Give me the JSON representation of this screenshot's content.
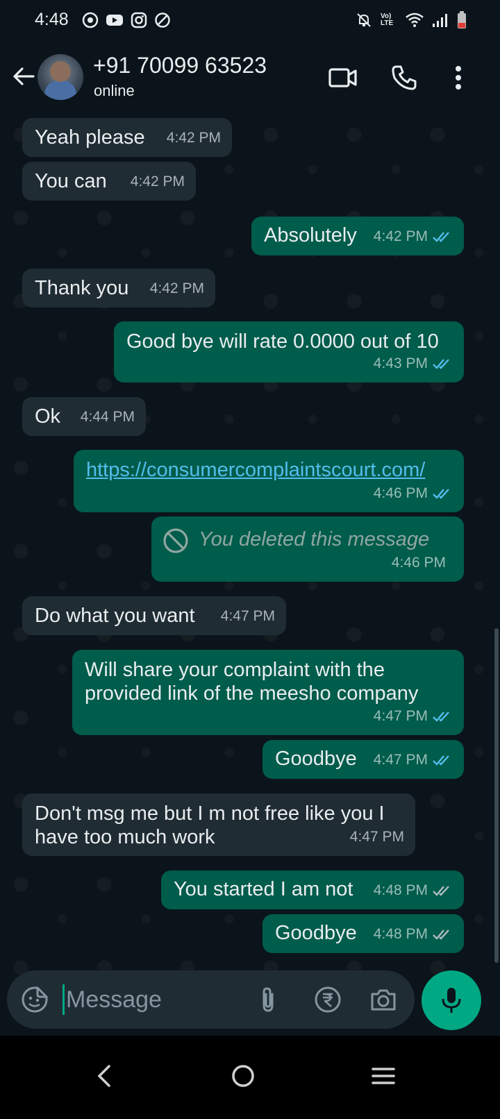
{
  "status_bar": {
    "time": "4:48",
    "app_icons": [
      "whatsapp-icon",
      "youtube-icon",
      "instagram-icon",
      "blocked-icon"
    ],
    "right_icons": [
      "mute-icon",
      "volte-icon",
      "wifi-icon",
      "signal-icon",
      "battery-low-icon"
    ],
    "volte_text": "Vo) LTE"
  },
  "header": {
    "contact_name": "+91 70099 63523",
    "status": "online"
  },
  "messages": [
    {
      "dir": "in",
      "text": "Yeah please",
      "time": "4:42 PM"
    },
    {
      "dir": "in",
      "text": "You can",
      "time": "4:42 PM"
    },
    {
      "dir": "out",
      "text": "Absolutely",
      "time": "4:42 PM",
      "read": true
    },
    {
      "dir": "in",
      "text": "Thank you",
      "time": "4:42 PM"
    },
    {
      "dir": "out",
      "text": "Good bye will rate 0.0000 out of 10",
      "time": "4:43 PM",
      "read": true
    },
    {
      "dir": "in",
      "text": "Ok",
      "time": "4:44 PM"
    },
    {
      "dir": "out",
      "text": "https://consumercomplaintscourt.com/",
      "time": "4:46 PM",
      "read": true,
      "link": true
    },
    {
      "dir": "out",
      "text": "You deleted this message",
      "time": "4:46 PM",
      "deleted": true
    },
    {
      "dir": "in",
      "text": "Do what you want",
      "time": "4:47 PM"
    },
    {
      "dir": "out",
      "text": "Will share your complaint with the provided link of the meesho company",
      "time": "4:47 PM",
      "read": true
    },
    {
      "dir": "out",
      "text": "Goodbye",
      "time": "4:47 PM",
      "read": true
    },
    {
      "dir": "in",
      "text": "Don't msg me but I m not free like you I have too much work",
      "time": "4:47 PM"
    },
    {
      "dir": "out",
      "text": "You started I am not",
      "time": "4:48 PM",
      "read": false
    },
    {
      "dir": "out",
      "text": "Goodbye",
      "time": "4:48 PM",
      "read": false
    }
  ],
  "composer": {
    "placeholder": "Message"
  },
  "colors": {
    "background": "#0b141a",
    "incoming_bubble": "#202c33",
    "outgoing_bubble": "#005c4b",
    "accent": "#00a884",
    "read_tick": "#53bdeb",
    "link": "#53bdeb"
  }
}
